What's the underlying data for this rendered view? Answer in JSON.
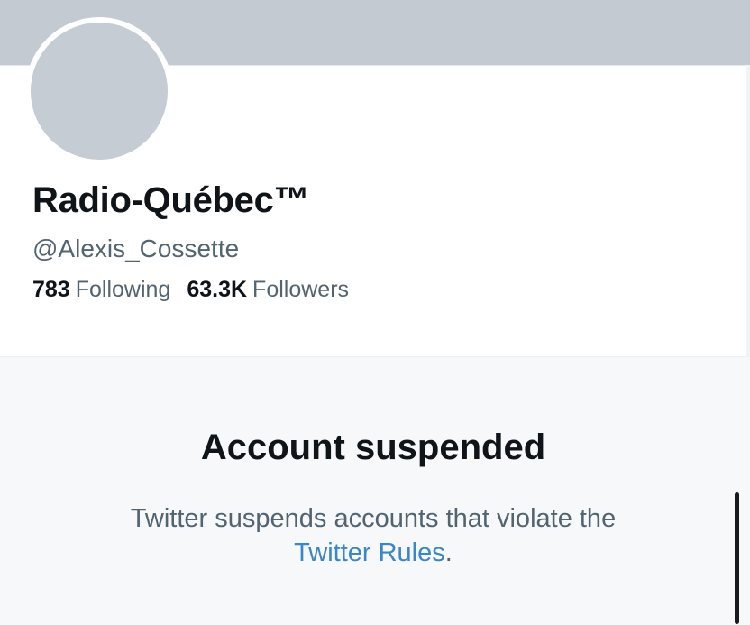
{
  "colors": {
    "banner": "#c3cad2",
    "avatar": "#c6ccd4",
    "text_primary": "#0f1419",
    "text_secondary": "#536471",
    "link": "#3a86c8",
    "panel_bg": "#f6f8f9"
  },
  "profile": {
    "display_name": "Radio-Québec™",
    "handle": "@Alexis_Cossette",
    "following_count": "783",
    "following_label": "Following",
    "followers_count": "63.3K",
    "followers_label": "Followers"
  },
  "suspension": {
    "title": "Account suspended",
    "message_line1": "Twitter suspends accounts that violate the",
    "rules_link_text": "Twitter Rules",
    "message_end": "."
  }
}
